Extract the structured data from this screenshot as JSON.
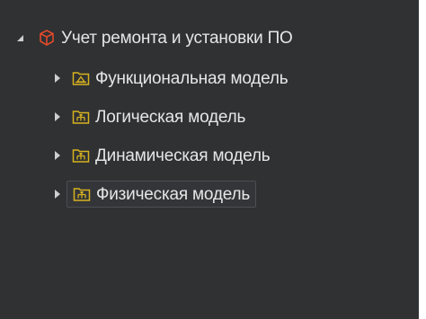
{
  "colors": {
    "panel_bg": "#2f3133",
    "text": "#e6e6e6",
    "arrow": "#cfcfcf",
    "package_icon": "#e04a2b",
    "folder_icon": "#d8b21f"
  },
  "tree": {
    "root": {
      "label": "Учет ремонта и установки ПО",
      "icon": "package-icon",
      "expanded": true
    },
    "children": [
      {
        "label": "Функциональная модель",
        "icon": "functional-model-folder-icon",
        "expanded": false
      },
      {
        "label": "Логическая модель",
        "icon": "logical-model-folder-icon",
        "expanded": false
      },
      {
        "label": "Динамическая модель",
        "icon": "dynamic-model-folder-icon",
        "expanded": false
      },
      {
        "label": "Физическая модель",
        "icon": "physical-model-folder-icon",
        "expanded": false,
        "selected": true
      }
    ]
  }
}
